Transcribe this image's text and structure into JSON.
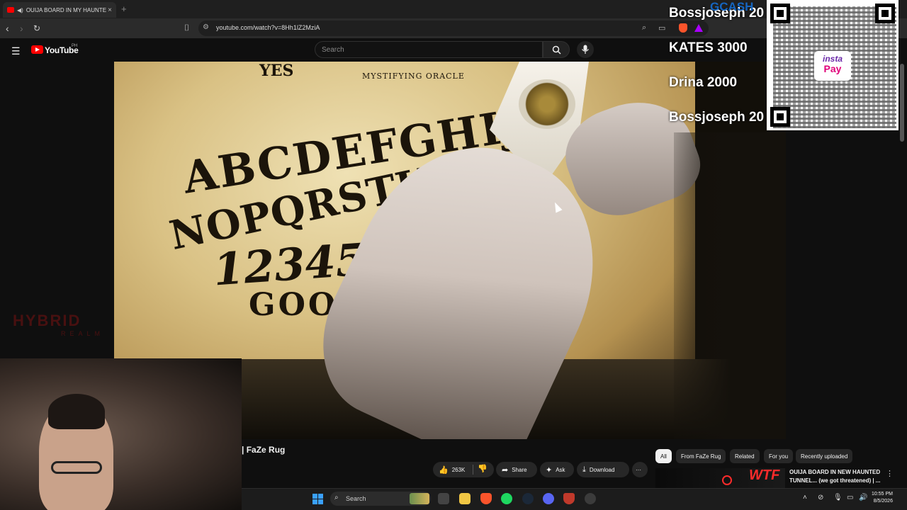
{
  "browser": {
    "tab_title": "OUIJA BOARD IN MY HAUNTE",
    "tab_close": "×",
    "new_tab": "+",
    "url": "youtube.com/watch?v=8Hh1lZ2MziA"
  },
  "youtube": {
    "logo_text": "YouTube",
    "region": "PH",
    "search_placeholder": "Search"
  },
  "video": {
    "board_letters_row1": "ABCDEFGHIJ",
    "board_letters_row2": "NOPQRSTUV",
    "board_numbers": "12345",
    "board_goodbye": "GOO",
    "board_yes": "YES",
    "board_brand": "MYSTIFYING ORACLE"
  },
  "overlay": {
    "gcash": "GCASH",
    "donations": [
      "Bossjoseph 20",
      "KATES 3000",
      "Drina 2000",
      "Bossjoseph 20"
    ],
    "instapay_top": "insta",
    "instapay_bottom": "Pay"
  },
  "watermark": {
    "line1": "HYBRID",
    "line2": "REALM"
  },
  "below_video": {
    "channel_name": "| FaZe Rug",
    "likes": "263K",
    "share": "Share",
    "ask": "Ask",
    "download": "Download",
    "more": "···"
  },
  "chips": [
    "All",
    "From FaZe Rug",
    "Related",
    "For you",
    "Recently uploaded"
  ],
  "related_video": {
    "title": "OUIJA BOARD IN NEW HAUNTED TUNNEL... (we got threatened) | ...",
    "thumb_text": "WTF"
  },
  "taskbar": {
    "search_label": "Search",
    "time": "10:55 PM",
    "date": "8/5/2026"
  },
  "colors": {
    "youtube_red": "#ff0000",
    "gcash_blue": "#1565c0",
    "windows_blue": "#3aa0ff"
  }
}
